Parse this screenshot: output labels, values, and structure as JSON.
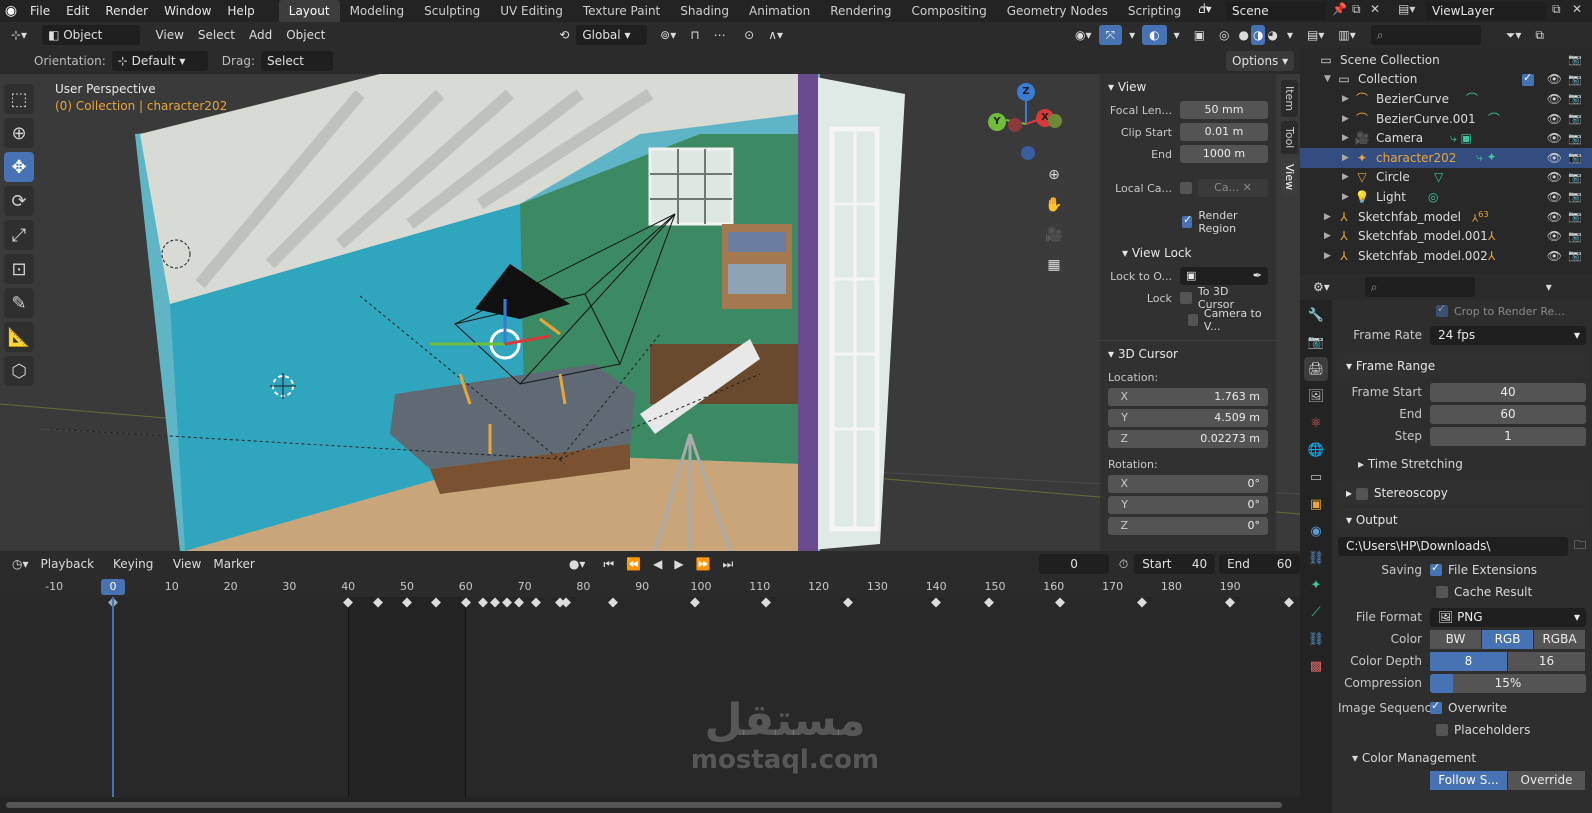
{
  "topbar": {
    "menus": [
      "File",
      "Edit",
      "Render",
      "Window",
      "Help"
    ],
    "workspaces": [
      "Layout",
      "Modeling",
      "Sculpting",
      "UV Editing",
      "Texture Paint",
      "Shading",
      "Animation",
      "Rendering",
      "Compositing",
      "Geometry Nodes",
      "Scripting"
    ],
    "active_workspace": "Layout",
    "scene": "Scene",
    "view_layer": "ViewLayer"
  },
  "viewport_header": {
    "mode": "Object Mode",
    "menus": [
      "View",
      "Select",
      "Add",
      "Object"
    ],
    "transform_orientation": "Global",
    "orientation_label": "Orientation:",
    "orientation_value": "Default",
    "drag_label": "Drag:",
    "drag_value": "Select Box",
    "options_label": "Options"
  },
  "viewport": {
    "perspective": "User Perspective",
    "context": "(0) Collection | character202",
    "gizmo": {
      "x": "X",
      "y": "Y",
      "z": "Z"
    }
  },
  "npanel": {
    "tabs": [
      "Item",
      "Tool",
      "View"
    ],
    "active_tab": "View",
    "view_section": "View",
    "focal_length_label": "Focal Len...",
    "focal_length": "50 mm",
    "clip_start_label": "Clip Start",
    "clip_start": "0.01 m",
    "clip_end_label": "End",
    "clip_end": "1000 m",
    "local_camera_label": "Local Ca...",
    "local_camera_value": "Ca...",
    "render_region": "Render Region",
    "view_lock_section": "View Lock",
    "lock_to_object_label": "Lock to O...",
    "lock_label": "Lock",
    "to_3d_cursor": "To 3D Cursor",
    "camera_to_view": "Camera to V...",
    "cursor_section": "3D Cursor",
    "location_label": "Location:",
    "location": {
      "x": "1.763 m",
      "y": "4.509 m",
      "z": "0.02273 m"
    },
    "rotation_label": "Rotation:",
    "rotation": {
      "x": "0°",
      "y": "0°",
      "z": "0°"
    },
    "axis": {
      "x": "X",
      "y": "Y",
      "z": "Z"
    }
  },
  "timeline": {
    "menus": [
      "Playback",
      "Keying",
      "View",
      "Marker"
    ],
    "current_frame": "0",
    "start_label": "Start",
    "start": "40",
    "end_label": "End",
    "end": "60",
    "ruler_ticks": [
      "-10",
      "0",
      "10",
      "20",
      "30",
      "40",
      "50",
      "60",
      "70",
      "80",
      "90",
      "100",
      "110",
      "120",
      "130",
      "140",
      "150",
      "160",
      "170",
      "180",
      "190"
    ],
    "keyframes": [
      40,
      45,
      50,
      55,
      60,
      63,
      65,
      67,
      69,
      72,
      76,
      77,
      85,
      99,
      111,
      125,
      140,
      149,
      161,
      175,
      190,
      200
    ]
  },
  "outliner": {
    "root": "Scene Collection",
    "collection": "Collection",
    "items": [
      {
        "name": "BezierCurve",
        "icon": "curve-icon",
        "color": "#e8a53a"
      },
      {
        "name": "BezierCurve.001",
        "icon": "curve-icon",
        "color": "#e8a53a"
      },
      {
        "name": "Camera",
        "icon": "camera-icon",
        "color": "#e8a53a"
      },
      {
        "name": "character202",
        "icon": "armature-icon",
        "color": "#e8a53a",
        "selected": true
      },
      {
        "name": "Circle",
        "icon": "mesh-icon",
        "color": "#e8a53a"
      },
      {
        "name": "Light",
        "icon": "light-icon",
        "color": "#e8a53a"
      }
    ],
    "top_items": [
      {
        "name": "Sketchfab_model",
        "badge": "63"
      },
      {
        "name": "Sketchfab_model.001"
      },
      {
        "name": "Sketchfab_model.002"
      }
    ]
  },
  "properties": {
    "crop_label": "Crop to Render Re...",
    "frame_rate_label": "Frame Rate",
    "frame_rate": "24 fps",
    "frame_range_section": "Frame Range",
    "frame_start_label": "Frame Start",
    "frame_start": "40",
    "end_label": "End",
    "end": "60",
    "step_label": "Step",
    "step": "1",
    "time_stretching": "Time Stretching",
    "stereoscopy": "Stereoscopy",
    "output_section": "Output",
    "output_path": "C:\\Users\\HP\\Downloads\\",
    "saving_label": "Saving",
    "file_extensions": "File Extensions",
    "cache_result": "Cache Result",
    "file_format_label": "File Format",
    "file_format": "PNG",
    "color_label": "Color",
    "color_options": [
      "BW",
      "RGB",
      "RGBA"
    ],
    "color_selected": "RGB",
    "color_depth_label": "Color Depth",
    "color_depth_options": [
      "8",
      "16"
    ],
    "color_depth_selected": "8",
    "compression_label": "Compression",
    "compression": "15%",
    "compression_value": 0.15,
    "image_sequence_label": "Image Sequence",
    "overwrite": "Overwrite",
    "placeholders": "Placeholders",
    "color_management": "Color Management",
    "follow_scene": "Follow S...",
    "override": "Override"
  },
  "watermark": {
    "arabic": "مستقل",
    "latin": "mostaql.com"
  },
  "colors": {
    "accent": "#4772b3",
    "selection": "#334d80",
    "object_orange": "#e8a53a"
  }
}
